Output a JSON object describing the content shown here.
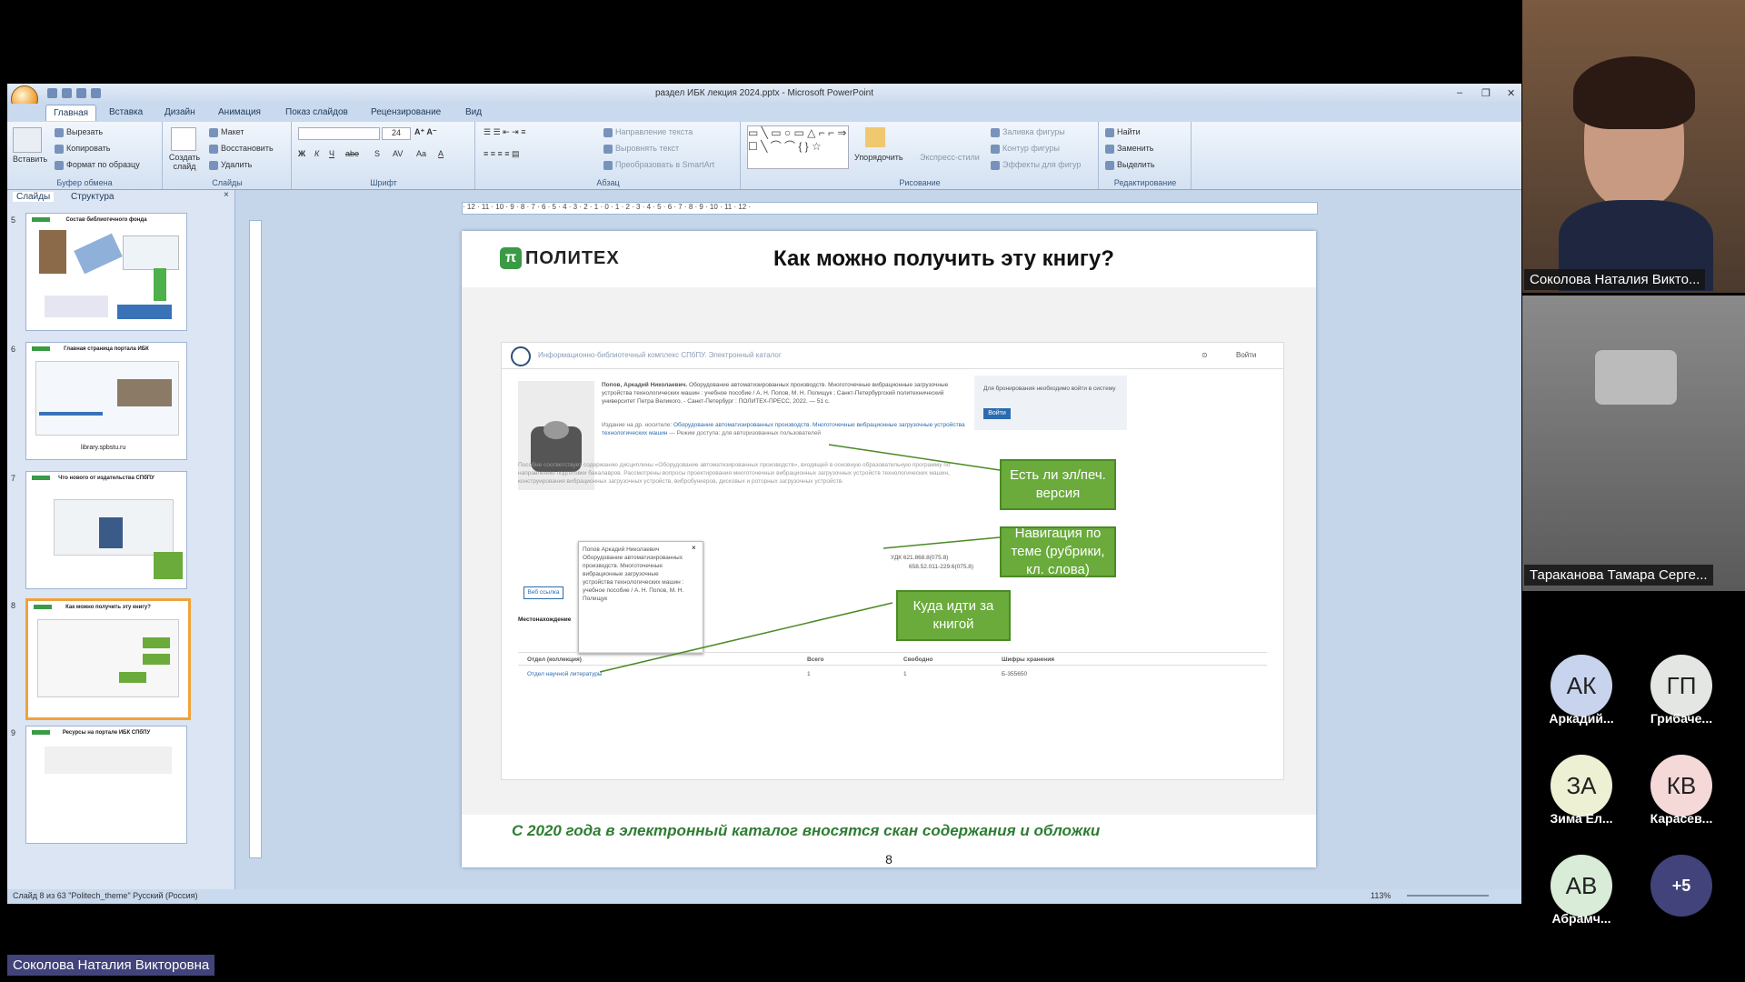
{
  "window": {
    "title": "раздел ИБК лекция 2024.pptx - Microsoft PowerPoint"
  },
  "ribbon": {
    "tabs": [
      "Главная",
      "Вставка",
      "Дизайн",
      "Анимация",
      "Показ слайдов",
      "Рецензирование",
      "Вид"
    ],
    "clipboard": {
      "paste": "Вставить",
      "cut": "Вырезать",
      "copy": "Копировать",
      "format": "Формат по образцу",
      "label": "Буфер обмена"
    },
    "slides": {
      "new": "Создать слайд",
      "layout": "Макет",
      "reset": "Восстановить",
      "delete": "Удалить",
      "label": "Слайды"
    },
    "font": {
      "size": "24",
      "label": "Шрифт"
    },
    "paragraph": {
      "dir": "Направление текста",
      "align": "Выровнять текст",
      "smartart": "Преобразовать в SmartArt",
      "label": "Абзац"
    },
    "drawing": {
      "arrange": "Упорядочить",
      "styles": "Экспресс-стили",
      "fill": "Заливка фигуры",
      "outline": "Контур фигуры",
      "effects": "Эффекты для фигур",
      "label": "Рисование"
    },
    "editing": {
      "find": "Найти",
      "replace": "Заменить",
      "select": "Выделить",
      "label": "Редактирование"
    }
  },
  "panel": {
    "tabs": [
      "Слайды",
      "Структура"
    ],
    "thumbs": [
      {
        "num": "5",
        "title": "Состав библиотечного фонда"
      },
      {
        "num": "6",
        "title": "Главная страница портала ИБК",
        "footer": "library.spbstu.ru"
      },
      {
        "num": "7",
        "title": "Что нового от издательства СПбПУ"
      },
      {
        "num": "8",
        "title": "Как можно получить эту книгу?"
      },
      {
        "num": "9",
        "title": "Ресурсы на портале ИБК СПбПУ"
      }
    ]
  },
  "slide": {
    "logo": "ПОЛИТЕХ",
    "title": "Как можно получить  эту книгу?",
    "catalog_header": "Информационно-библиотечный комплекс СПбПУ. Электронный каталог",
    "catalog_login": "Войти",
    "login_hint": "Для бронирования необходимо войти в систему",
    "login_button": "Войти",
    "book_author": "Попов, Аркадий Николаевич.",
    "book_desc": "Оборудование автоматизированных производств. Многоточечные вибрационные загрузочные устройства технологических машин : учебное пособие / А. Н. Попов, М. Н. Полищук ; Санкт-Петербургский политехнический университет Петра Великого. - Санкт-Петербург : ПОЛИТЕХ-ПРЕСС, 2022. — 51 с.",
    "box_version": "Есть ли эл/печ. версия",
    "box_nav": "Навигация по теме (рубрики, кл. слова)",
    "box_where": "Куда идти за книгой",
    "popup_text": "Попов Аркадий Николаевич Оборудование автоматизированных производств. Многоточечные вибрационные загрузочные устройства технологических машин : учебное пособие / А. Н. Попов, М. Н. Полищук",
    "popup_link": "Веб ссылка",
    "location_title": "Местонахождение",
    "table_headers": [
      "Отдел (коллекция)",
      "Всего",
      "Свободно",
      "Шифры хранения"
    ],
    "table_row": [
      "Отдел научной литературы",
      "1",
      "1",
      "Б-355650"
    ],
    "udk": "УДК  621.868.8(075.8)",
    "bbk": "658.52.011-229.6(075.8)",
    "caption": "С 2020 года  в электронный каталог вносятся скан содержания и обложки",
    "page": "8"
  },
  "statusbar": {
    "left": "Слайд 8 из 63    \"Politech_theme\"    Русский (Россия)",
    "zoom": "113%"
  },
  "participants": {
    "cam1_name": "Соколова Наталия Викто...",
    "cam2_name": "Тараканова Тамара Серге...",
    "avatars": [
      {
        "initials": "АК",
        "name": "Аркадий...",
        "bg": "#c8d4ee"
      },
      {
        "initials": "ГП",
        "name": "Грибаче...",
        "bg": "#e4e6e4"
      },
      {
        "initials": "ЗА",
        "name": "Зима Ел...",
        "bg": "#eef0d4"
      },
      {
        "initials": "КВ",
        "name": "Карасев...",
        "bg": "#f5d8d8"
      },
      {
        "initials": "АВ",
        "name": "Абрамч...",
        "bg": "#d8ecd8"
      },
      {
        "initials": "+5",
        "name": "",
        "bg": "#41437a"
      }
    ]
  },
  "speaker": "Соколова Наталия Викторовна"
}
